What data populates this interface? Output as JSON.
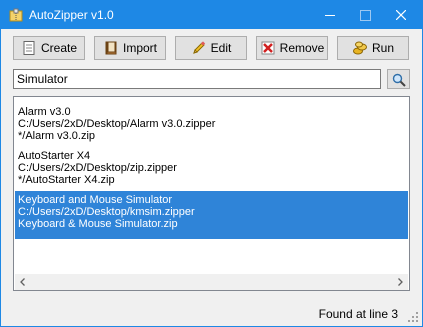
{
  "window": {
    "title": "AutoZipper v1.0"
  },
  "toolbar": {
    "create_label": "Create",
    "import_label": "Import",
    "edit_label": "Edit",
    "remove_label": "Remove",
    "run_label": "Run"
  },
  "search": {
    "value": "Simulator"
  },
  "list": {
    "items": [
      {
        "name": "Alarm v3.0",
        "path": "C:/Users/2xD/Desktop/Alarm v3.0.zipper",
        "zip": "*/Alarm v3.0.zip",
        "selected": false
      },
      {
        "name": "AutoStarter X4",
        "path": "C:/Users/2xD/Desktop/zip.zipper",
        "zip": "*/AutoStarter X4.zip",
        "selected": false
      },
      {
        "name": "Keyboard and Mouse Simulator",
        "path": "C:/Users/2xD/Desktop/kmsim.zipper",
        "zip": "Keyboard & Mouse Simulator.zip",
        "selected": true
      }
    ]
  },
  "status": {
    "text": "Found at line 3"
  },
  "colors": {
    "titlebar": "#1e88e5",
    "selection": "#2f84d8"
  },
  "icons": {
    "app": "app-icon",
    "create": "document-icon",
    "import": "book-icon",
    "edit": "pencil-icon",
    "remove": "red-x-icon",
    "run": "coins-icon",
    "search": "magnifier-icon"
  }
}
